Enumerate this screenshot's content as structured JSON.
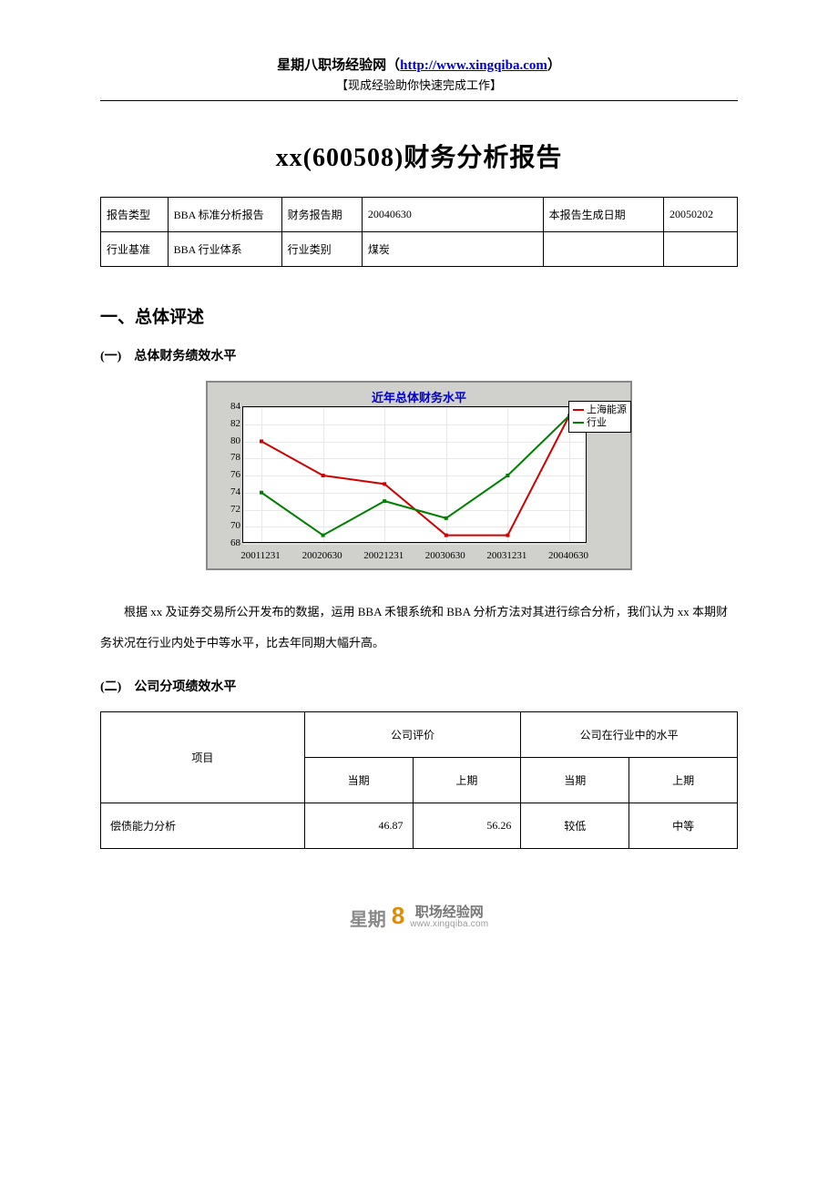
{
  "header": {
    "site_name": "星期八职场经验网",
    "open_paren": "（",
    "close_paren": "）",
    "url": "http://www.xingqiba.com",
    "subtitle": "【现成经验助你快速完成工作】"
  },
  "doc_title": "xx(600508)财务分析报告",
  "info_table": {
    "r1": {
      "c1": "报告类型",
      "c2": "BBA 标准分析报告",
      "c3": "财务报告期",
      "c4": "20040630",
      "c5": "本报告生成日期",
      "c6": "20050202"
    },
    "r2": {
      "c1": "行业基准",
      "c2": "BBA 行业体系",
      "c3": "行业类别",
      "c4": "煤炭",
      "c5": "",
      "c6": ""
    }
  },
  "sections": {
    "s1": "一、总体评述",
    "s1_1": "(一)　总体财务绩效水平",
    "s1_2": "(二)　公司分项绩效水平"
  },
  "paragraph1": "根据 xx 及证券交易所公开发布的数据，运用 BBA 禾银系统和 BBA 分析方法对其进行综合分析，我们认为 xx 本期财务状况在行业内处于中等水平，比去年同期大幅升高。",
  "chart_data": {
    "type": "line",
    "title": "近年总体财务水平",
    "xlabel": "",
    "ylabel": "",
    "ylim": [
      68,
      84
    ],
    "y_ticks": [
      68,
      70,
      72,
      74,
      76,
      78,
      80,
      82,
      84
    ],
    "categories": [
      "20011231",
      "20020630",
      "20021231",
      "20030630",
      "20031231",
      "20040630"
    ],
    "series": [
      {
        "name": "上海能源",
        "color": "#d00000",
        "values": [
          80,
          76,
          75,
          69,
          69,
          83
        ]
      },
      {
        "name": "行业",
        "color": "#008000",
        "values": [
          74,
          69,
          73,
          71,
          76,
          83
        ]
      }
    ]
  },
  "perf_table": {
    "head": {
      "c1": "项目",
      "g1": "公司评价",
      "g2": "公司在行业中的水平",
      "sub_cur": "当期",
      "sub_prev": "上期"
    },
    "rows": [
      {
        "name": "偿债能力分析",
        "eval_cur": "46.87",
        "eval_prev": "56.26",
        "level_cur": "较低",
        "level_prev": "中等"
      }
    ]
  },
  "footer": {
    "brand1": "星期",
    "brand_num": "8",
    "brand2": "职场经验网",
    "url": "www.xingqiba.com"
  }
}
